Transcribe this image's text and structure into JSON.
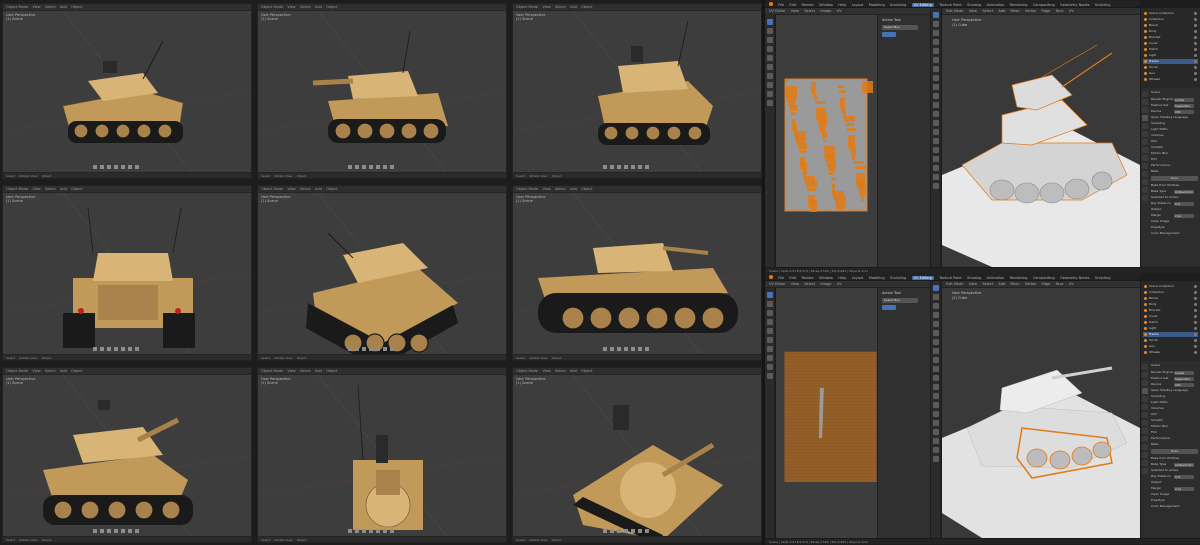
{
  "viewports": [
    {
      "label": "User Perspective",
      "sub": "(1) Scene"
    },
    {
      "label": "User Perspective",
      "sub": "(1) Scene"
    },
    {
      "label": "User Perspective",
      "sub": "(1) Scene"
    },
    {
      "label": "User Perspective",
      "sub": "(1) Scene"
    },
    {
      "label": "User Perspective",
      "sub": "(1) Scene"
    },
    {
      "label": "User Perspective",
      "sub": "(1) Scene"
    },
    {
      "label": "User Perspective",
      "sub": "(1) Scene"
    },
    {
      "label": "User Perspective",
      "sub": "(1) Scene"
    },
    {
      "label": "User Perspective",
      "sub": "(1) Scene"
    }
  ],
  "viewport_bar": {
    "b1": "Object Mode",
    "b2": "View",
    "b3": "Select",
    "b4": "Add",
    "b5": "Object"
  },
  "viewport_foot": {
    "f1": "Select",
    "f2": "Rotate View",
    "f3": "Object"
  },
  "top_menu": [
    "File",
    "Edit",
    "Render",
    "Window",
    "Help",
    "Layout",
    "Modeling",
    "Sculpting",
    "UV Editing",
    "Texture Paint",
    "Shading",
    "Animation",
    "Rendering",
    "Compositing",
    "Geometry Nodes",
    "Scripting"
  ],
  "active_workspace": "UV Editing",
  "scene_name": "Scene",
  "view_layer": "ViewLayer",
  "uv_header": {
    "mode": "UV Editor",
    "view": "View",
    "select": "Select",
    "image": "Image",
    "uv": "UV"
  },
  "npanel": {
    "title": "Active Tool",
    "tool": "Select Box"
  },
  "view3d_header": {
    "mode": "Edit Mode",
    "view": "View",
    "select": "Select",
    "add": "Add",
    "mesh": "Mesh",
    "vertex": "Vertex",
    "edge": "Edge",
    "face": "Face",
    "uv": "UV"
  },
  "view3d_label": {
    "title": "User Perspective",
    "sub": "(1) Cube"
  },
  "outliner": {
    "title": "Scene Collection",
    "rows": [
      "Scene Collection",
      "Collection",
      "Barrel",
      "Body",
      "Bracket",
      "Cover",
      "Hatch",
      "Light",
      "Tracks",
      "Turret",
      "Gun",
      "Wheels"
    ],
    "selected_index": 8
  },
  "properties": {
    "section": "Scene",
    "rows": [
      {
        "label": "Render Engine",
        "value": "Cycles"
      },
      {
        "label": "Feature Set",
        "value": "Supported"
      },
      {
        "label": "Device",
        "value": "CPU"
      },
      {
        "label": "Open Shading Language",
        "value": ""
      },
      {
        "label": "Sampling",
        "value": ""
      },
      {
        "label": "Light Paths",
        "value": ""
      },
      {
        "label": "Volumes",
        "value": ""
      },
      {
        "label": "Hair",
        "value": ""
      },
      {
        "label": "Simplify",
        "value": ""
      },
      {
        "label": "Motion Blur",
        "value": ""
      },
      {
        "label": "Film",
        "value": ""
      },
      {
        "label": "Performance",
        "value": ""
      },
      {
        "label": "Bake",
        "value": ""
      }
    ],
    "bake_button": "Bake",
    "bake_rows": [
      {
        "label": "Bake from Multires",
        "value": ""
      },
      {
        "label": "Bake Type",
        "value": "Ambient Occ."
      },
      {
        "label": "Selected to Active",
        "value": ""
      },
      {
        "label": "Ray Distance",
        "value": "0 m"
      },
      {
        "label": "Output",
        "value": ""
      },
      {
        "label": "Margin",
        "value": "2 px"
      },
      {
        "label": "Clear Image",
        "value": ""
      },
      {
        "label": "Freestyle",
        "value": ""
      },
      {
        "label": "Color Management",
        "value": ""
      }
    ]
  },
  "status_bar": {
    "text": "Scene | Verts 4,573/4,573 | Faces 4,504 | Tris 8,962 | Objects 1/11"
  },
  "colors": {
    "uv_orange": "#e07b17",
    "tank_tan": "#c19a5a",
    "select_blue": "#4772b3"
  }
}
